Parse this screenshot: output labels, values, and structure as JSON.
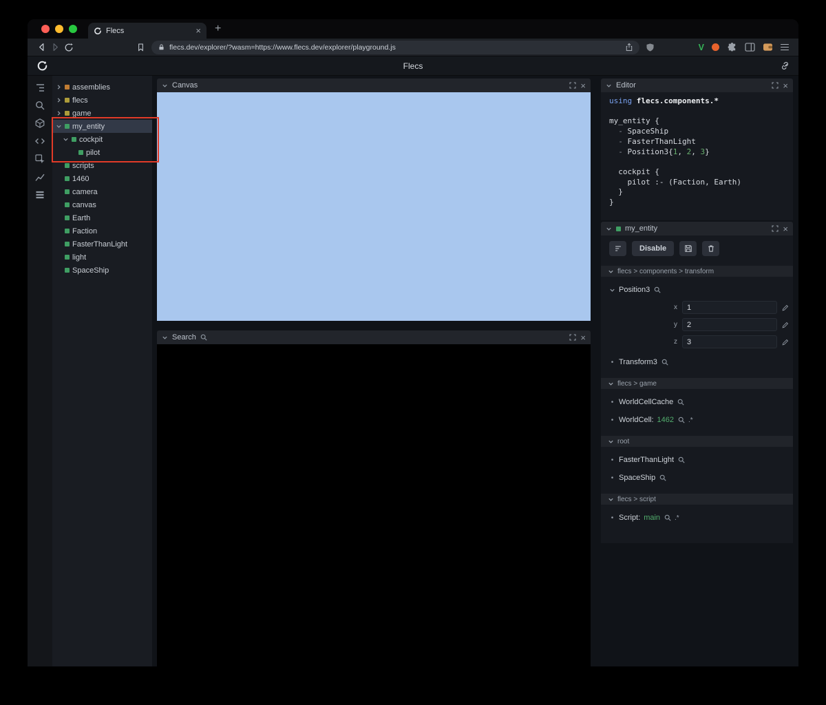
{
  "glyphs": {
    "close": "×",
    "new_tab": "+",
    "v_badge": "V",
    "bullet": "•"
  },
  "annotation": {
    "highlight_box_color": "#e23b28"
  },
  "colors": {
    "canvas_fill": "#a9c7ee",
    "entity_green": "#3f9e63",
    "module_orange": "#c07c33",
    "module_yellow": "#ad9c3a",
    "selection": "#323947",
    "value_green": "#52ad6d"
  },
  "browser": {
    "tab_title": "Flecs",
    "url": "flecs.dev/explorer/?wasm=https://www.flecs.dev/explorer/playground.js"
  },
  "app_header": {
    "title": "Flecs"
  },
  "sidebar": {
    "icons": [
      "tree-view-icon",
      "search-icon",
      "package-icon",
      "code-icon",
      "inspect-icon",
      "stats-icon",
      "table-icon"
    ]
  },
  "tree": {
    "items": [
      {
        "label": "assemblies",
        "color": "#c07c33",
        "arrow": "collapsed",
        "indent": 0
      },
      {
        "label": "flecs",
        "color": "#ad9c3a",
        "arrow": "collapsed",
        "indent": 0
      },
      {
        "label": "game",
        "color": "#ad9c3a",
        "arrow": "collapsed",
        "indent": 0
      },
      {
        "label": "my_entity",
        "color": "#3f9e63",
        "arrow": "expanded",
        "indent": 0,
        "selected": true
      },
      {
        "label": "cockpit",
        "color": "#3f9e63",
        "arrow": "expanded",
        "indent": 1
      },
      {
        "label": "pilot",
        "color": "#3f9e63",
        "arrow": "leaf",
        "indent": 2
      },
      {
        "label": "scripts",
        "color": "#3f9e63",
        "arrow": "leaf",
        "indent": 0
      },
      {
        "label": "1460",
        "color": "#3f9e63",
        "arrow": "leaf",
        "indent": 0
      },
      {
        "label": "camera",
        "color": "#3f9e63",
        "arrow": "leaf",
        "indent": 0
      },
      {
        "label": "canvas",
        "color": "#3f9e63",
        "arrow": "leaf",
        "indent": 0
      },
      {
        "label": "Earth",
        "color": "#3f9e63",
        "arrow": "leaf",
        "indent": 0
      },
      {
        "label": "Faction",
        "color": "#3f9e63",
        "arrow": "leaf",
        "indent": 0
      },
      {
        "label": "FasterThanLight",
        "color": "#3f9e63",
        "arrow": "leaf",
        "indent": 0
      },
      {
        "label": "light",
        "color": "#3f9e63",
        "arrow": "leaf",
        "indent": 0
      },
      {
        "label": "SpaceShip",
        "color": "#3f9e63",
        "arrow": "leaf",
        "indent": 0
      }
    ]
  },
  "panels": {
    "canvas": {
      "title": "Canvas"
    },
    "search": {
      "title": "Search"
    },
    "editor": {
      "title": "Editor"
    }
  },
  "editor_code": {
    "lines": [
      [
        {
          "t": "using ",
          "c": "kw"
        },
        {
          "t": "flecs.components.*",
          "c": "bold"
        }
      ],
      [],
      [
        {
          "t": "my_entity {",
          "c": "plain"
        }
      ],
      [
        {
          "t": "  - ",
          "c": "dim"
        },
        {
          "t": "SpaceShip",
          "c": "plain"
        }
      ],
      [
        {
          "t": "  - ",
          "c": "dim"
        },
        {
          "t": "FasterThanLight",
          "c": "plain"
        }
      ],
      [
        {
          "t": "  - ",
          "c": "dim"
        },
        {
          "t": "Position3{",
          "c": "plain"
        },
        {
          "t": "1",
          "c": "num"
        },
        {
          "t": ", ",
          "c": "plain"
        },
        {
          "t": "2",
          "c": "num"
        },
        {
          "t": ", ",
          "c": "plain"
        },
        {
          "t": "3",
          "c": "num"
        },
        {
          "t": "}",
          "c": "plain"
        }
      ],
      [],
      [
        {
          "t": "  cockpit {",
          "c": "plain"
        }
      ],
      [
        {
          "t": "    pilot :- (Faction, Earth)",
          "c": "plain"
        }
      ],
      [
        {
          "t": "  }",
          "c": "plain"
        }
      ],
      [
        {
          "t": "}",
          "c": "plain"
        }
      ]
    ]
  },
  "inspector": {
    "title": "my_entity",
    "toolbar": {
      "disable_label": "Disable"
    },
    "sections": [
      {
        "header": "flecs > components > transform",
        "rows": [
          {
            "name": "Position3",
            "expanded": true,
            "fields": [
              {
                "label": "x",
                "value": "1"
              },
              {
                "label": "y",
                "value": "2"
              },
              {
                "label": "z",
                "value": "3"
              }
            ]
          },
          {
            "name": "Transform3"
          }
        ]
      },
      {
        "header": "flecs > game",
        "rows": [
          {
            "name": "WorldCellCache"
          },
          {
            "name": "WorldCell:",
            "value": "1462",
            "suffix": ".*"
          }
        ]
      },
      {
        "header": "root",
        "rows": [
          {
            "name": "FasterThanLight"
          },
          {
            "name": "SpaceShip"
          }
        ]
      },
      {
        "header": "flecs > script",
        "rows": [
          {
            "name": "Script:",
            "value": "main",
            "suffix": ".*"
          }
        ]
      }
    ]
  }
}
